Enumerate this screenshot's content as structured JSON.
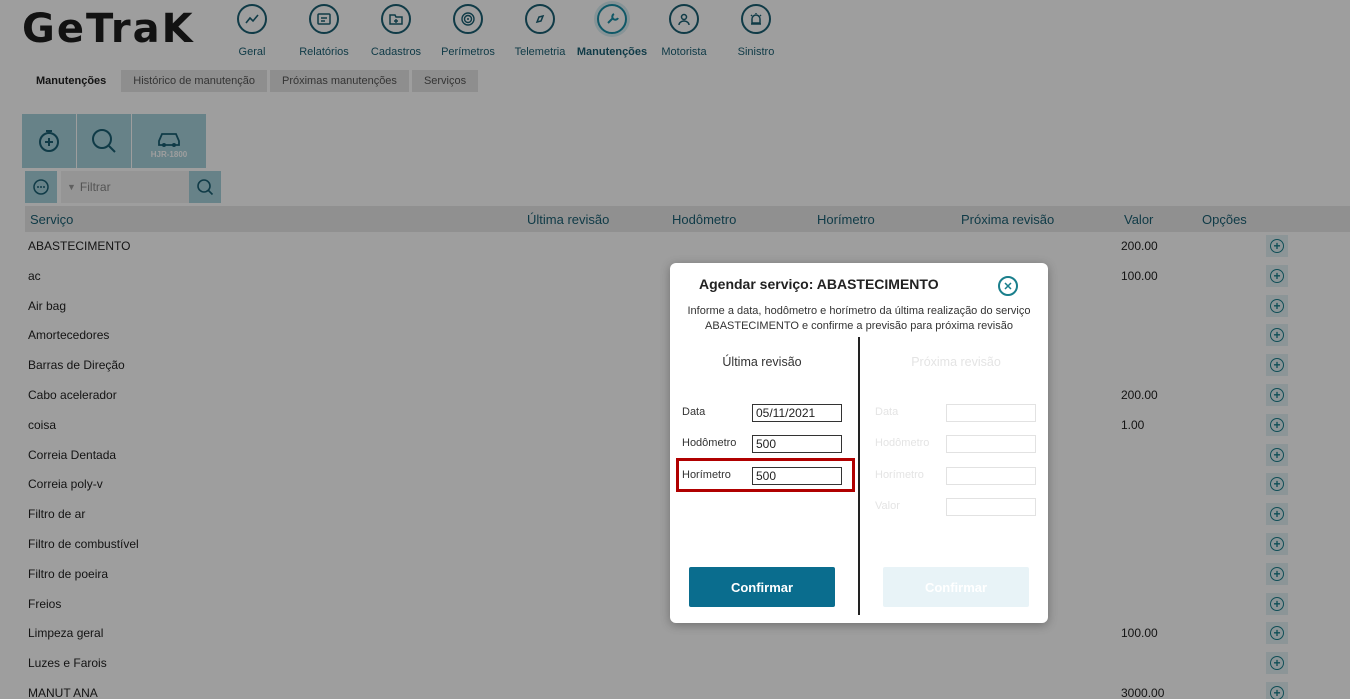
{
  "app": {
    "logo": "GeTraK"
  },
  "nav": [
    {
      "label": "Geral",
      "icon": "chart-icon"
    },
    {
      "label": "Relatórios",
      "icon": "report-icon"
    },
    {
      "label": "Cadastros",
      "icon": "folder-plus-icon"
    },
    {
      "label": "Perímetros",
      "icon": "fingerprint-icon"
    },
    {
      "label": "Telemetria",
      "icon": "compass-icon"
    },
    {
      "label": "Manutenções",
      "icon": "wrench-icon",
      "active": true
    },
    {
      "label": "Motorista",
      "icon": "driver-icon"
    },
    {
      "label": "Sinistro",
      "icon": "alarm-icon"
    }
  ],
  "subtabs": [
    "Manutenções",
    "Histórico de manutenção",
    "Próximas manutenções",
    "Serviços"
  ],
  "toolbar": {
    "vehicle_plate": "HJR-1800",
    "filter_placeholder": "Filtrar"
  },
  "table": {
    "headers": {
      "servico": "Serviço",
      "ultima": "Última revisão",
      "hodometro": "Hodômetro",
      "horimetro": "Horímetro",
      "proxima": "Próxima revisão",
      "valor": "Valor",
      "opcoes": "Opções"
    },
    "rows": [
      {
        "name": "ABASTECIMENTO",
        "valor": "200.00"
      },
      {
        "name": "ac",
        "valor": "100.00"
      },
      {
        "name": "Air bag",
        "valor": ""
      },
      {
        "name": "Amortecedores",
        "valor": ""
      },
      {
        "name": "Barras de Direção",
        "valor": ""
      },
      {
        "name": "Cabo acelerador",
        "valor": "200.00"
      },
      {
        "name": "coisa",
        "valor": "1.00"
      },
      {
        "name": "Correia Dentada",
        "valor": ""
      },
      {
        "name": "Correia poly-v",
        "valor": ""
      },
      {
        "name": "Filtro de ar",
        "valor": ""
      },
      {
        "name": "Filtro de combustível",
        "valor": ""
      },
      {
        "name": "Filtro de poeira",
        "valor": ""
      },
      {
        "name": "Freios",
        "valor": ""
      },
      {
        "name": "Limpeza geral",
        "valor": "100.00"
      },
      {
        "name": "Luzes e Farois",
        "valor": ""
      },
      {
        "name": "MANUT ANA",
        "valor": "3000.00"
      }
    ]
  },
  "modal": {
    "title": "Agendar serviço: ABASTECIMENTO",
    "description_line1": "Informe a data, hodômetro e horímetro da última realização do serviço",
    "description_line2": "ABASTECIMENTO e confirme a previsão para próxima revisão",
    "left": {
      "title": "Última revisão",
      "data_label": "Data",
      "data_value": "05/11/2021",
      "hodometro_label": "Hodômetro",
      "hodometro_value": "500",
      "horimetro_label": "Horímetro",
      "horimetro_value": "500",
      "confirm": "Confirmar"
    },
    "right": {
      "title": "Próxima revisão",
      "data_label": "Data",
      "hodometro_label": "Hodômetro",
      "horimetro_label": "Horímetro",
      "valor_label": "Valor",
      "confirm": "Confirmar"
    }
  },
  "colors": {
    "primary": "#0a6d8e",
    "accent": "#1a7f8c",
    "highlight": "#b00000"
  }
}
